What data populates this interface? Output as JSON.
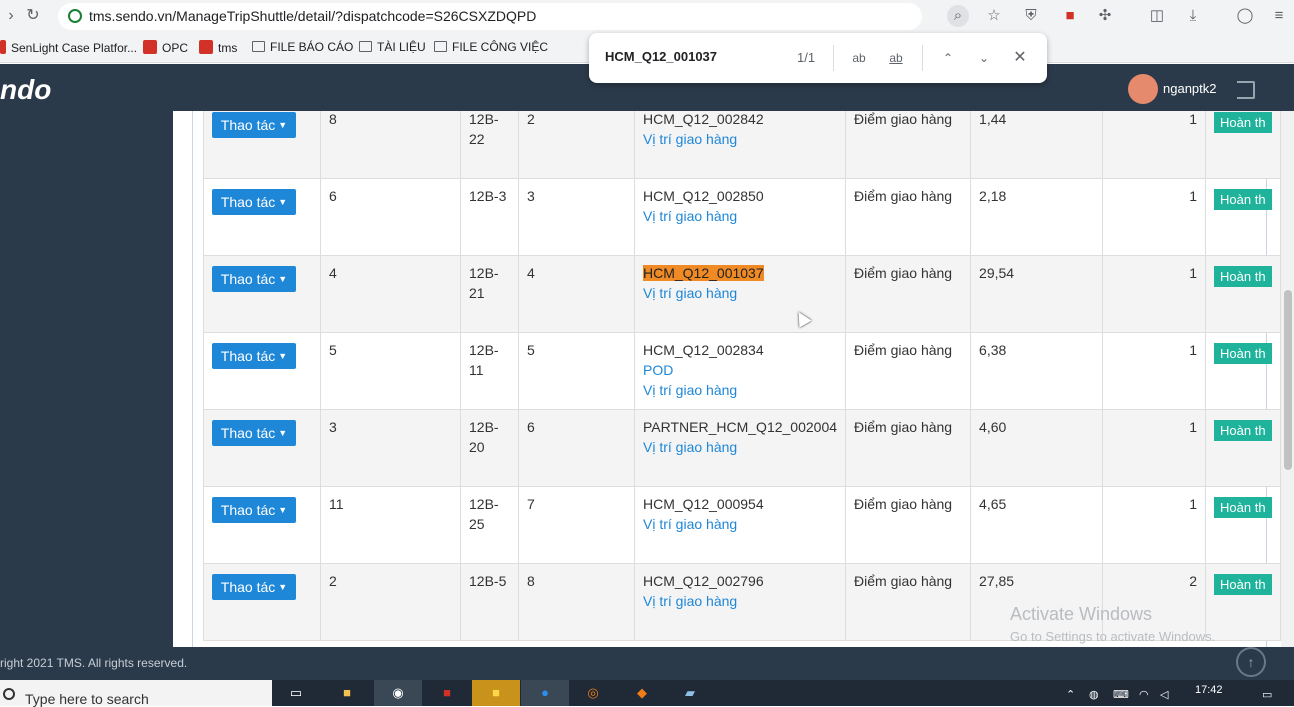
{
  "browser": {
    "url": "tms.sendo.vn/ManageTripShuttle/detail/?dispatchcode=S26CSXZDQPD",
    "bookmarks": [
      "SenLight Case Platfor...",
      "OPC",
      "tms",
      "FILE BÁO CÁO",
      "TÀI LIỆU",
      "FILE CÔNG VIỆC"
    ]
  },
  "findbar": {
    "query": "HCM_Q12_001037",
    "count": "1/1",
    "match_case_label": "ab",
    "whole_word_label": "ab"
  },
  "header": {
    "logo": "ndo",
    "username": "nganptk2"
  },
  "table": {
    "action_label": "Thao tác",
    "rows": [
      {
        "no": "8",
        "code": "12B-22",
        "seq": "2",
        "dest": "HCM_Q12_002842",
        "links": [
          "Vị trí giao hàng"
        ],
        "type": "Điểm giao hàng",
        "weight": "1,44",
        "qty": "1",
        "status": "Hoàn th"
      },
      {
        "no": "6",
        "code": "12B-3",
        "seq": "3",
        "dest": "HCM_Q12_002850",
        "links": [
          "Vị trí giao hàng"
        ],
        "type": "Điểm giao hàng",
        "weight": "2,18",
        "qty": "1",
        "status": "Hoàn th"
      },
      {
        "no": "4",
        "code": "12B-21",
        "seq": "4",
        "dest": "HCM_Q12_001037",
        "links": [
          "Vị trí giao hàng"
        ],
        "type": "Điểm giao hàng",
        "weight": "29,54",
        "qty": "1",
        "status": "Hoàn th",
        "highlight": true
      },
      {
        "no": "5",
        "code": "12B-11",
        "seq": "5",
        "dest": "HCM_Q12_002834",
        "links": [
          "POD",
          "Vị trí giao hàng"
        ],
        "type": "Điểm giao hàng",
        "weight": "6,38",
        "qty": "1",
        "status": "Hoàn th"
      },
      {
        "no": "3",
        "code": "12B-20",
        "seq": "6",
        "dest": "PARTNER_HCM_Q12_002004",
        "links": [
          "Vị trí giao hàng"
        ],
        "type": "Điểm giao hàng",
        "weight": "4,60",
        "qty": "1",
        "status": "Hoàn th"
      },
      {
        "no": "11",
        "code": "12B-25",
        "seq": "7",
        "dest": "HCM_Q12_000954",
        "links": [
          "Vị trí giao hàng"
        ],
        "type": "Điểm giao hàng",
        "weight": "4,65",
        "qty": "1",
        "status": "Hoàn th"
      },
      {
        "no": "2",
        "code": "12B-5",
        "seq": "8",
        "dest": "HCM_Q12_002796",
        "links": [
          "Vị trí giao hàng"
        ],
        "type": "Điểm giao hàng",
        "weight": "27,85",
        "qty": "2",
        "status": "Hoàn th"
      }
    ]
  },
  "footer": {
    "copyright": "right 2021 TMS. All rights reserved."
  },
  "watermark": {
    "title": "Activate Windows",
    "subtitle": "Go to Settings to activate Windows."
  },
  "taskbar": {
    "search_placeholder": "Type here to search",
    "time": "17:42"
  }
}
